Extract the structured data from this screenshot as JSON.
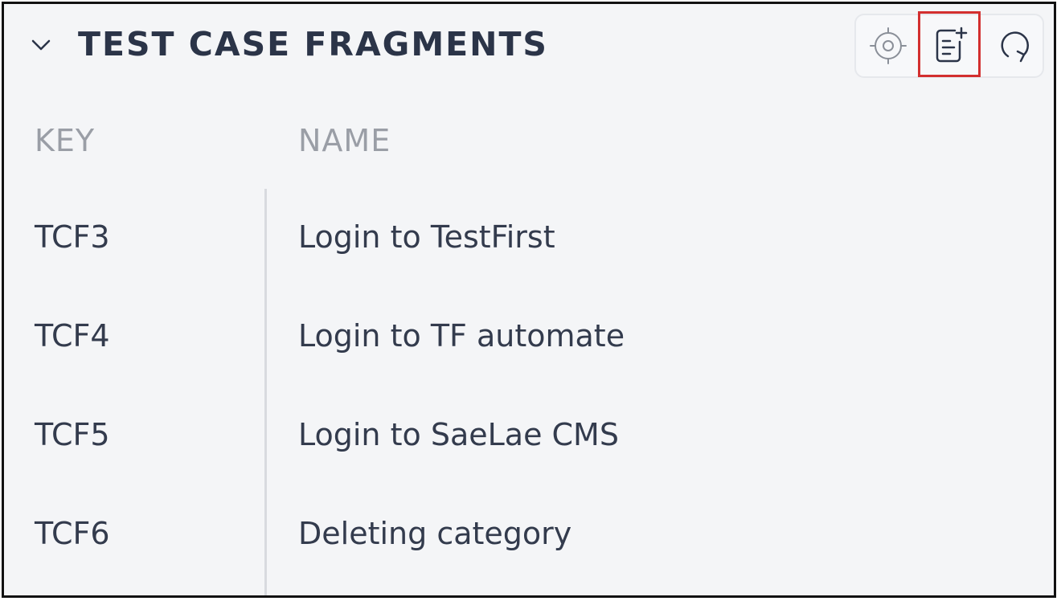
{
  "panel": {
    "title": "TEST CASE FRAGMENTS",
    "toolbar": {
      "locate_icon": "crosshair-target-icon",
      "add_icon": "add-document-icon",
      "refresh_icon": "refresh-icon",
      "highlight_color": "#d32f2f"
    }
  },
  "table": {
    "columns": [
      "KEY",
      "NAME"
    ],
    "rows": [
      {
        "key": "TCF3",
        "name": "Login to TestFirst"
      },
      {
        "key": "TCF4",
        "name": "Login to TF automate"
      },
      {
        "key": "TCF5",
        "name": "Login to SaeLae CMS"
      },
      {
        "key": "TCF6",
        "name": "Deleting category"
      }
    ]
  },
  "colors": {
    "background": "#f4f5f7",
    "title": "#2b3448",
    "header_text": "#9a9ea6",
    "body_text": "#333b4d"
  }
}
